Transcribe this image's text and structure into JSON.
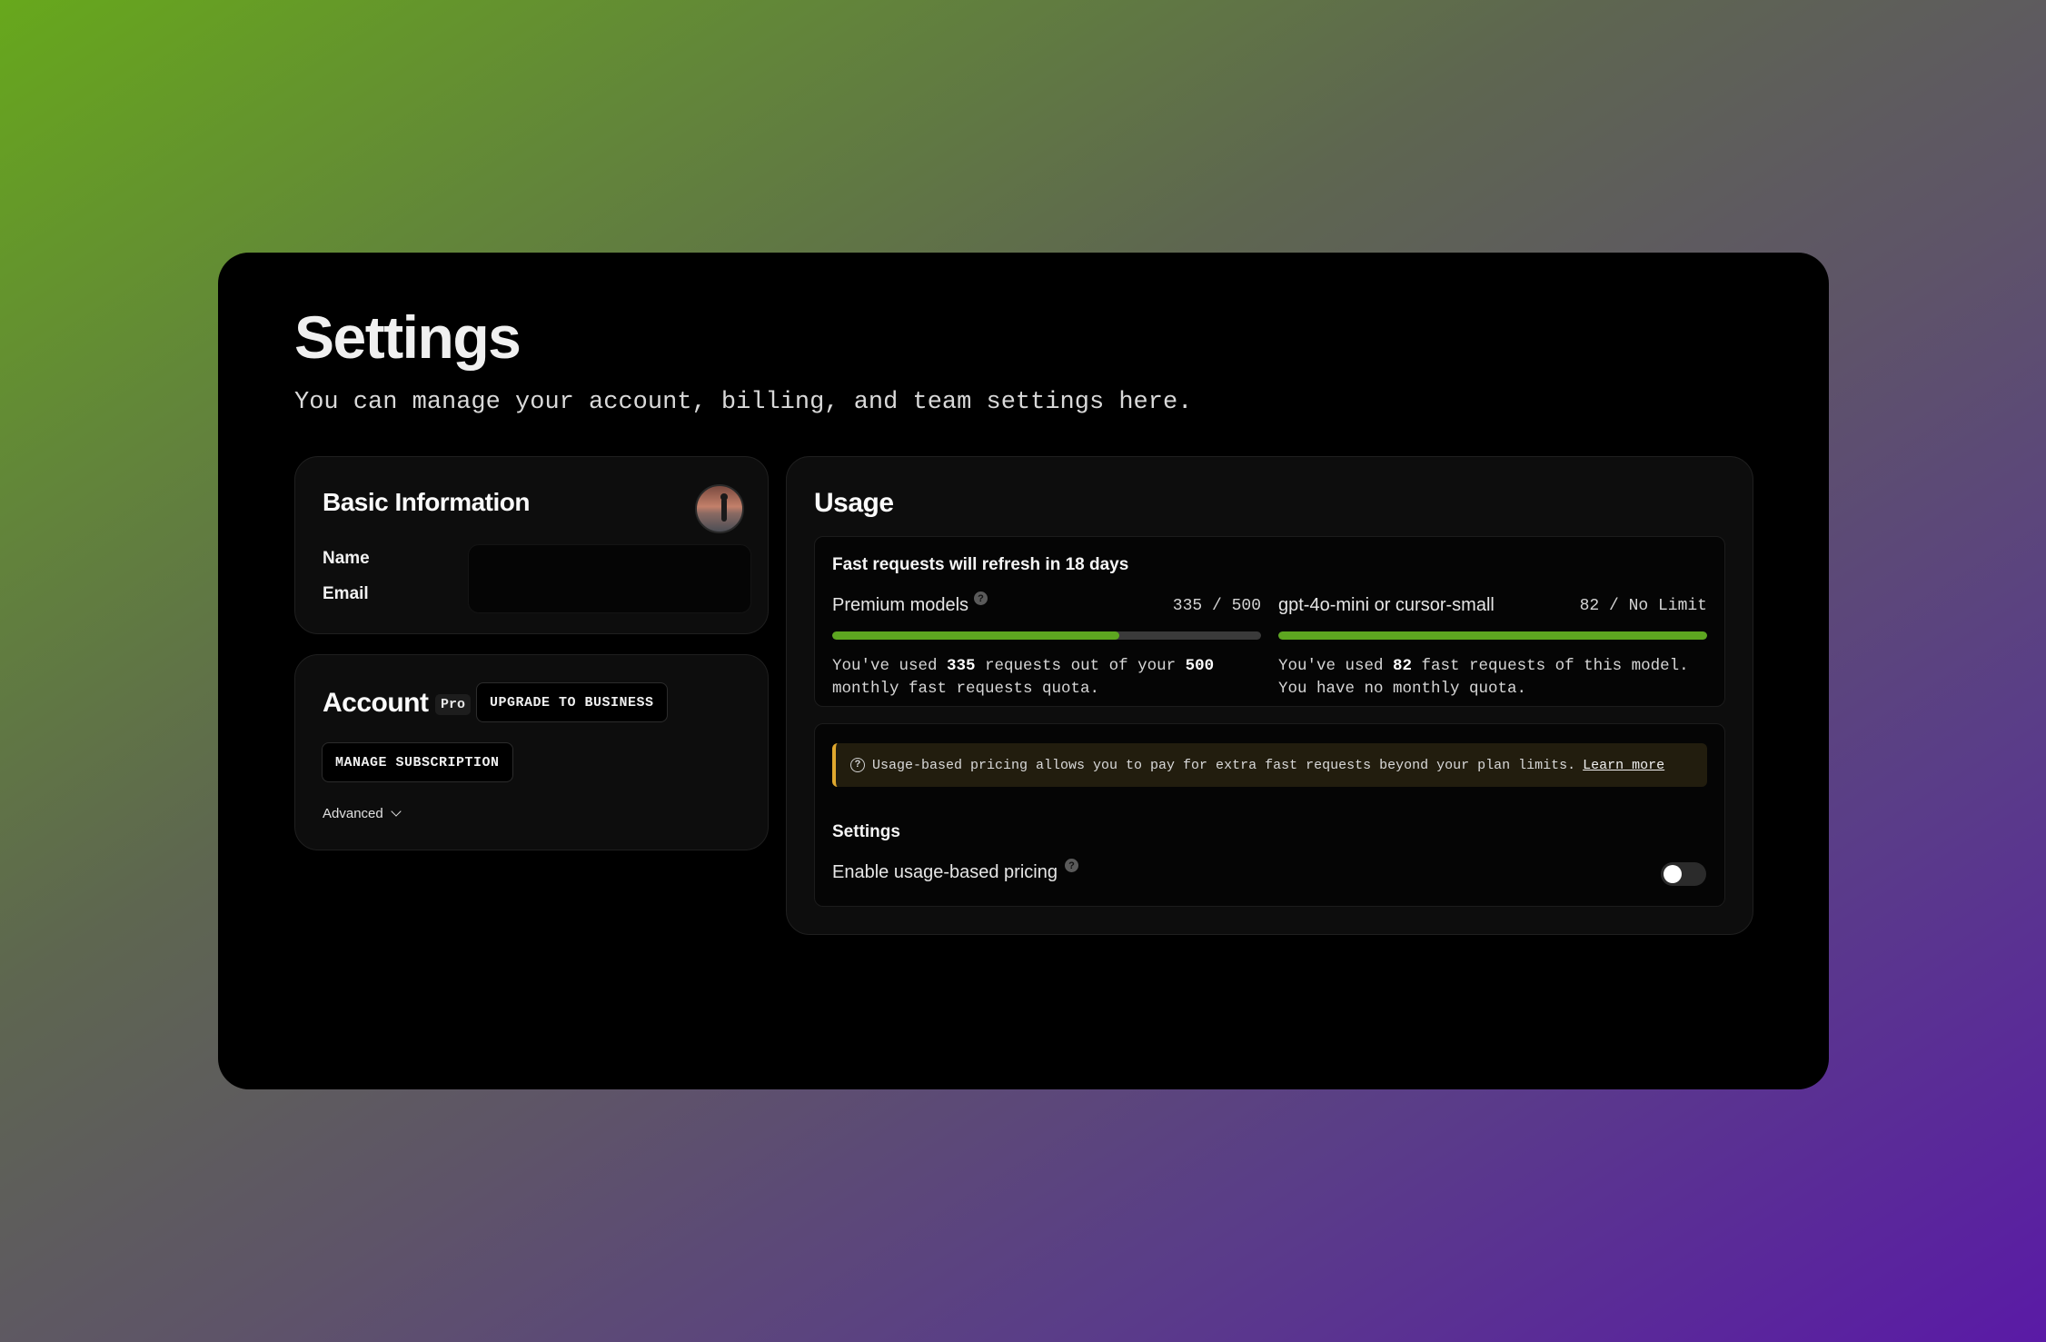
{
  "page": {
    "title": "Settings",
    "subtitle": "You can manage your account, billing, and team settings here."
  },
  "basic_info": {
    "title": "Basic Information",
    "name_label": "Name",
    "email_label": "Email",
    "name_value": "",
    "avatar_icon": "user-photo-avatar"
  },
  "account": {
    "title": "Account",
    "plan_badge": "Pro",
    "upgrade_label": "UPGRADE TO BUSINESS",
    "manage_label": "MANAGE SUBSCRIPTION",
    "advanced_label": "Advanced"
  },
  "usage": {
    "title": "Usage",
    "refresh_text": "Fast requests will refresh in 18 days",
    "premium": {
      "name": "Premium models",
      "count": "335 / 500",
      "used": 335,
      "quota": 500,
      "progress_fraction": 0.67,
      "desc_prefix": "You've used ",
      "desc_used": "335",
      "desc_mid": " requests out of your ",
      "desc_quota": "500",
      "desc_suffix": " monthly fast requests quota."
    },
    "mini": {
      "name": "gpt-4o-mini or cursor-small",
      "count": "82 / No Limit",
      "used": 82,
      "progress_fraction": 1.0,
      "desc_prefix": "You've used ",
      "desc_used": "82",
      "desc_suffix": " fast requests of this model. You have no monthly quota."
    },
    "notice_text": "Usage-based pricing allows you to pay for extra fast requests beyond your plan limits.",
    "notice_link": "Learn more",
    "settings_title": "Settings",
    "toggle_label": "Enable usage-based pricing",
    "toggle_on": false
  },
  "colors": {
    "progress_fill": "#5da620",
    "progress_track": "#3a3a3a",
    "notice_accent": "#e0a82e"
  },
  "icons": {
    "help": "question-circle-icon",
    "info": "info-circle-icon",
    "chevron": "chevron-down-icon"
  }
}
